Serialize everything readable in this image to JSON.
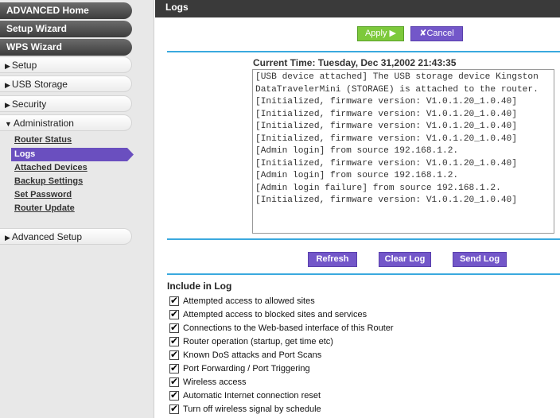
{
  "sidebar": {
    "advanced_home": "ADVANCED Home",
    "setup_wizard": "Setup Wizard",
    "wps_wizard": "WPS Wizard",
    "setup": "Setup",
    "usb_storage": "USB Storage",
    "security": "Security",
    "administration": "Administration",
    "admin_items": [
      "Router Status",
      "Logs",
      "Attached Devices",
      "Backup Settings",
      "Set Password",
      "Router Update"
    ],
    "advanced_setup": "Advanced Setup"
  },
  "header": {
    "title": "Logs"
  },
  "actions": {
    "apply": "Apply ▶",
    "cancel": "✘Cancel"
  },
  "logs": {
    "current_time": "Current Time: Tuesday, Dec 31,2002 21:43:35",
    "lines": [
      "[USB device attached] The USB storage device Kingston",
      "DataTravelerMini (STORAGE) is attached to the router.",
      "[Initialized, firmware version: V1.0.1.20_1.0.40]",
      "[Initialized, firmware version: V1.0.1.20_1.0.40]",
      "[Initialized, firmware version: V1.0.1.20_1.0.40]",
      "[Initialized, firmware version: V1.0.1.20_1.0.40]",
      "[Admin login] from source 192.168.1.2.",
      "[Initialized, firmware version: V1.0.1.20_1.0.40]",
      "[Admin login] from source 192.168.1.2.",
      "[Admin login failure] from source 192.168.1.2.",
      "[Initialized, firmware version: V1.0.1.20_1.0.40]"
    ]
  },
  "buttons": {
    "refresh": "Refresh",
    "clear_log": "Clear Log",
    "send_log": "Send Log"
  },
  "include": {
    "title": "Include in Log",
    "items": [
      "Attempted access to allowed sites",
      "Attempted access to blocked sites and services",
      "Connections to the Web-based interface of this Router",
      "Router operation (startup, get time etc)",
      "Known DoS attacks and Port Scans",
      "Port Forwarding / Port Triggering",
      "Wireless access",
      "Automatic Internet connection reset",
      "Turn off wireless signal by schedule"
    ]
  }
}
